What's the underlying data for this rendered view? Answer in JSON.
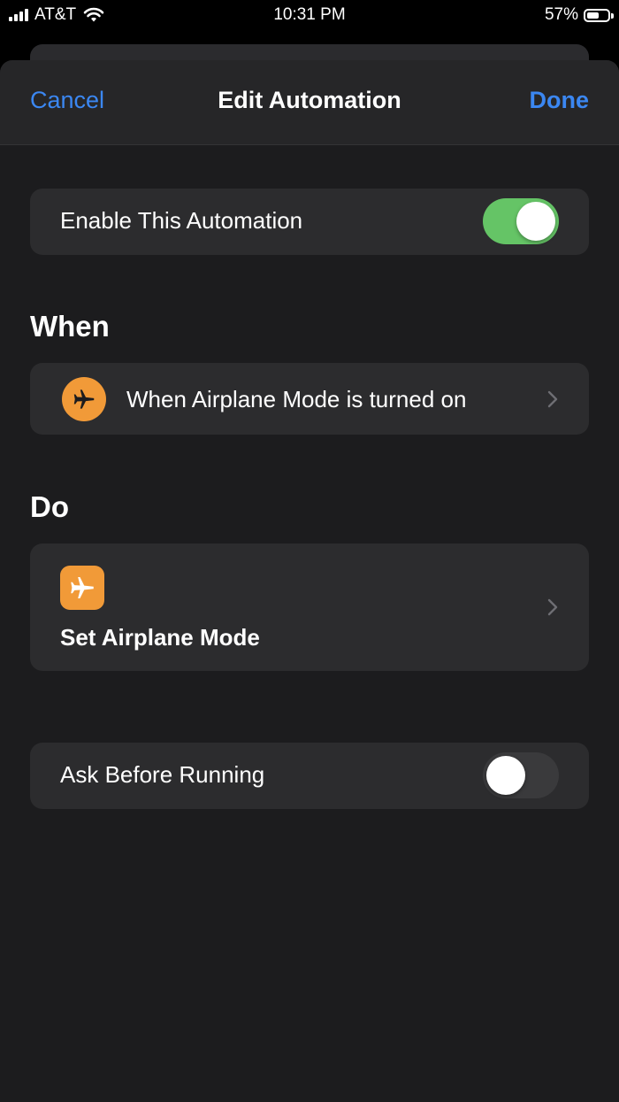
{
  "status_bar": {
    "carrier": "AT&T",
    "time": "10:31 PM",
    "battery_percent": "57%",
    "battery_level": 0.57,
    "icons": [
      "signal-icon",
      "wifi-icon",
      "battery-icon"
    ]
  },
  "nav": {
    "cancel_label": "Cancel",
    "title": "Edit Automation",
    "done_label": "Done"
  },
  "enable": {
    "label": "Enable This Automation",
    "on": true
  },
  "when": {
    "header": "When",
    "trigger_label": "When Airplane Mode is turned on",
    "icon": "airplane-icon"
  },
  "do": {
    "header": "Do",
    "action_label": "Set Airplane Mode",
    "icon": "airplane-icon"
  },
  "ask": {
    "label": "Ask Before Running",
    "on": false
  },
  "colors": {
    "accent": "#3b87f2",
    "toggle_on": "#65c466",
    "toggle_off": "#3a3a3c",
    "icon_orange": "#f19a38",
    "card": "#2c2c2e",
    "sheet": "#1c1c1e"
  }
}
